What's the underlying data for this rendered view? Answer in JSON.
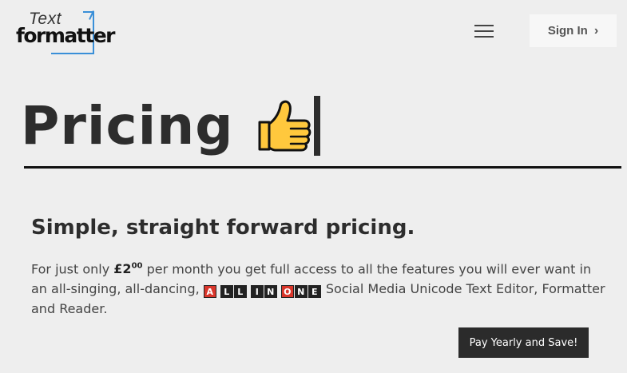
{
  "header": {
    "logo_top": "Text",
    "logo_bottom": "formatter",
    "signin_label": "Sign In",
    "menu_icon": "hamburger-menu-icon",
    "chevron_icon": "chevron-right-icon"
  },
  "hero": {
    "title": "Pricing",
    "emoji": "thumbs-up-icon"
  },
  "pricing": {
    "subtitle": "Simple, straight forward pricing.",
    "intro": "For just only ",
    "price": "£2",
    "price_sup": "00",
    "text_1": " per month you get full access to all the features you will ever want in an all-singing, all-dancing, ",
    "tiles_word1": [
      "A"
    ],
    "tiles_word2": [
      "L",
      "L"
    ],
    "tiles_word3": [
      "I",
      "N"
    ],
    "tiles_word4": [
      "O",
      "N",
      "E"
    ],
    "text_2": " Social Media Unicode Text Editor, Formatter and Reader.",
    "button_label": "Pay Yearly and Save!"
  },
  "colors": {
    "background": "#eeeeee",
    "accent_blue": "#3a8fd8",
    "tile_red": "#d9362b",
    "button_dark": "#2b2b2b"
  }
}
